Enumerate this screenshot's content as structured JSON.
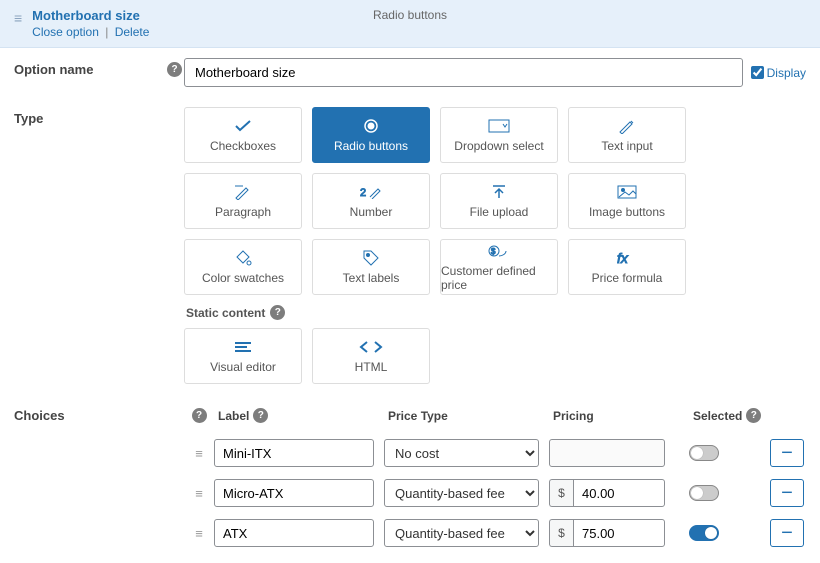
{
  "header": {
    "title": "Motherboard size",
    "close_label": "Close option",
    "delete_label": "Delete",
    "type_label": "Radio buttons"
  },
  "option_name": {
    "label": "Option name",
    "value": "Motherboard size",
    "display_label": "Display"
  },
  "type_section": {
    "label": "Type",
    "static_label": "Static content",
    "cells": [
      {
        "label": "Checkboxes",
        "selected": false
      },
      {
        "label": "Radio buttons",
        "selected": true
      },
      {
        "label": "Dropdown select",
        "selected": false
      },
      {
        "label": "Text input",
        "selected": false
      },
      {
        "label": "Paragraph",
        "selected": false
      },
      {
        "label": "Number",
        "selected": false
      },
      {
        "label": "File upload",
        "selected": false
      },
      {
        "label": "Image buttons",
        "selected": false
      },
      {
        "label": "Color swatches",
        "selected": false
      },
      {
        "label": "Text labels",
        "selected": false
      },
      {
        "label": "Customer defined price",
        "selected": false
      },
      {
        "label": "Price formula",
        "selected": false
      }
    ],
    "static_cells": [
      {
        "label": "Visual editor"
      },
      {
        "label": "HTML"
      }
    ]
  },
  "choices": {
    "label": "Choices",
    "headers": {
      "label": "Label",
      "ptype": "Price Type",
      "pricing": "Pricing",
      "selected": "Selected"
    },
    "ptype_options": {
      "no_cost": "No cost",
      "qty_fee": "Quantity-based fee"
    },
    "currency": "$",
    "rows": [
      {
        "label": "Mini-ITX",
        "ptype": "no_cost",
        "price": "",
        "selected": false
      },
      {
        "label": "Micro-ATX",
        "ptype": "qty_fee",
        "price": "40.00",
        "selected": false
      },
      {
        "label": "ATX",
        "ptype": "qty_fee",
        "price": "75.00",
        "selected": true
      }
    ]
  }
}
